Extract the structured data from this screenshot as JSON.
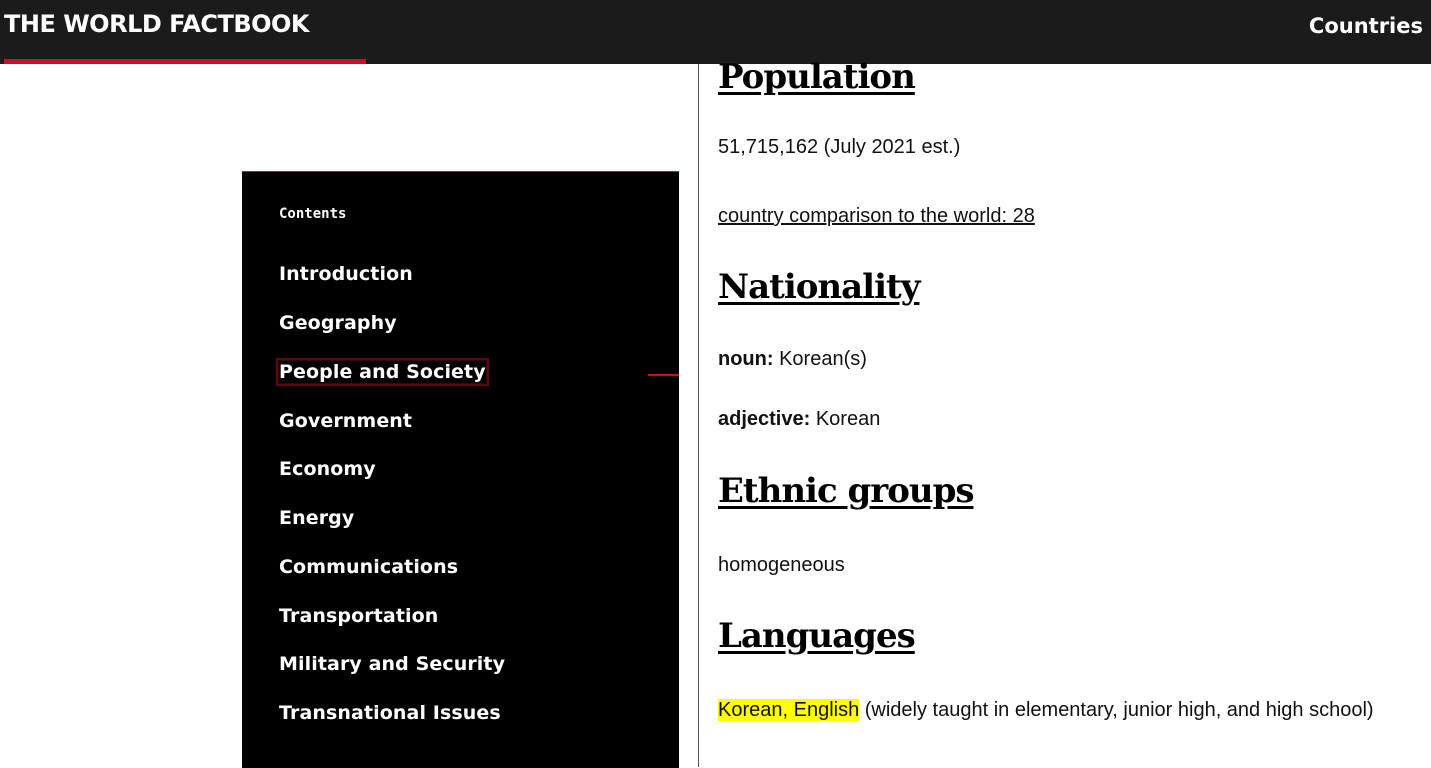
{
  "header": {
    "brand": "THE WORLD FACTBOOK",
    "nav_link": "Countries",
    "background": "#1b1b1b",
    "accent": "#c8102e"
  },
  "sidebar": {
    "label": "Contents",
    "items": [
      {
        "label": "Introduction"
      },
      {
        "label": "Geography"
      },
      {
        "label": "People and Society",
        "active": true
      },
      {
        "label": "Government"
      },
      {
        "label": "Economy"
      },
      {
        "label": "Energy"
      },
      {
        "label": "Communications"
      },
      {
        "label": "Transportation"
      },
      {
        "label": "Military and Security"
      },
      {
        "label": "Transnational Issues"
      }
    ]
  },
  "main": {
    "population": {
      "heading": "Population",
      "value": "51,715,162 (July 2021 est.)",
      "comparison": "country comparison to the world: 28"
    },
    "nationality": {
      "heading": "Nationality",
      "noun_label": "noun:",
      "noun_value": " Korean(s)",
      "adjective_label": "adjective:",
      "adjective_value": " Korean"
    },
    "ethnic_groups": {
      "heading": "Ethnic groups",
      "value": "homogeneous"
    },
    "languages": {
      "heading": "Languages",
      "highlighted": "Korean, English",
      "rest": " (widely taught in elementary, junior high, and high school)"
    }
  }
}
